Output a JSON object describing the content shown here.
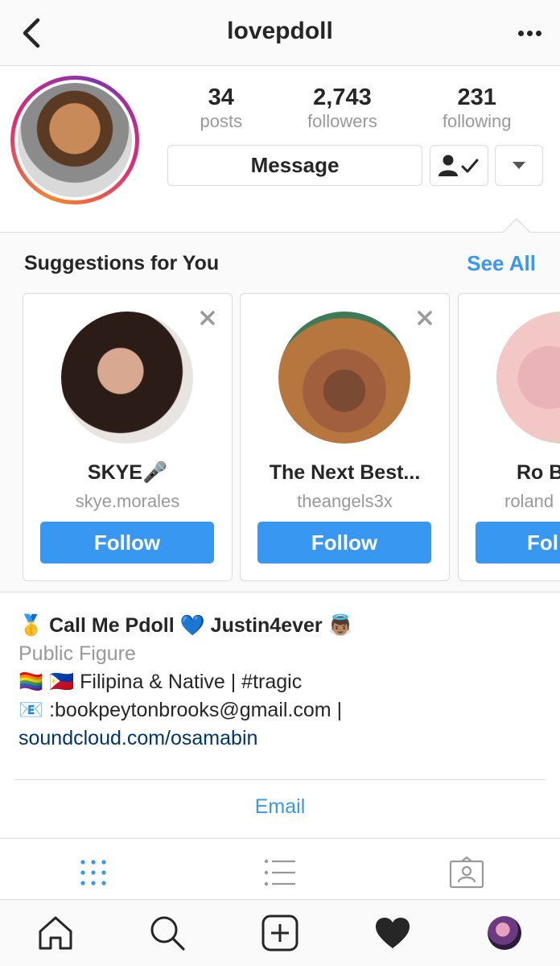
{
  "header": {
    "username": "lovepdoll",
    "back_icon": "chevron-left-icon",
    "more_icon": "more-horizontal-icon"
  },
  "profile": {
    "stats": [
      {
        "value": "34",
        "label": "posts"
      },
      {
        "value": "2,743",
        "label": "followers"
      },
      {
        "value": "231",
        "label": "following"
      }
    ],
    "message_label": "Message",
    "follow_state_icon": "person-check-icon",
    "dropdown_icon": "caret-down-icon"
  },
  "suggestions": {
    "title": "Suggestions for You",
    "see_all": "See All",
    "cards": [
      {
        "name": "SKYE🎤",
        "handle": "skye.morales",
        "button": "Follow"
      },
      {
        "name": "The Next Best...",
        "handle": "theangels3x",
        "button": "Follow"
      },
      {
        "name": "Ro B",
        "handle": "roland",
        "button": "Fol"
      }
    ]
  },
  "bio": {
    "name": "🥇 Call Me Pdoll 💙 Justin4ever 👼🏽",
    "category": "Public Figure",
    "line1": "🏳️‍🌈 🇵🇭  Filipina & Native | #tragic",
    "line2": "📧 :bookpeytonbrooks@gmail.com |",
    "link": "soundcloud.com/osamabin"
  },
  "contact": {
    "email_label": "Email"
  },
  "view_tabs": [
    "grid-icon",
    "list-icon",
    "tagged-icon"
  ],
  "bottom_nav": [
    "home-icon",
    "search-icon",
    "new-post-icon",
    "activity-heart-icon",
    "profile-avatar"
  ],
  "colors": {
    "accent": "#3897f0",
    "link": "#003569",
    "muted": "#999999",
    "border": "#dbdbdb"
  }
}
